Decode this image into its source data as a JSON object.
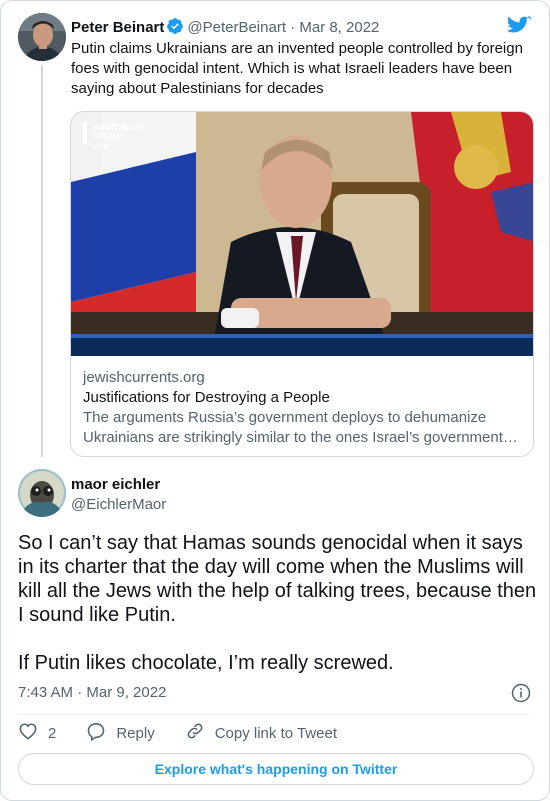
{
  "parent_tweet": {
    "author_name": "Peter Beinart",
    "handle": "@PeterBeinart",
    "separator": "·",
    "date": "Mar 8, 2022",
    "text": "Putin claims Ukrainians are an invented people controlled by foreign foes with genocidal intent. Which is what Israeli leaders have been saying about Palestinians for decades",
    "link_card": {
      "domain": "jewishcurrents.org",
      "title": "Justifications for Destroying a People",
      "description_line1": "The arguments Russia’s government deploys to dehumanize",
      "description_line2": "Ukrainians are strikingly similar to the ones Israel’s government…",
      "image_logo_line1": "НАСТОЯЩЕЕ",
      "image_logo_line2": "ВРЕМЯ",
      "image_logo_live": "LIVE"
    }
  },
  "reply_tweet": {
    "author_name": "maor eichler",
    "handle": "@EichlerMaor",
    "paragraph1": "So I can’t say that Hamas sounds genocidal when it says in its charter that the day will come when the Muslims will kill all the Jews with the help of talking trees, because then I sound like Putin.",
    "paragraph2": "If Putin likes chocolate, I’m really screwed.",
    "timestamp": "7:43 AM · Mar 9, 2022"
  },
  "actions": {
    "like_count": "2",
    "reply_label": "Reply",
    "copy_link_label": "Copy link to Tweet"
  },
  "explore_button_label": "Explore what's happening on Twitter",
  "colors": {
    "accent": "#1d9bf0",
    "text_primary": "#0f1419",
    "text_secondary": "#536471",
    "border": "#cfd9de"
  },
  "icons": [
    "twitter-bird-icon",
    "verified-badge-icon",
    "info-icon",
    "heart-icon",
    "reply-bubble-icon",
    "link-icon"
  ]
}
